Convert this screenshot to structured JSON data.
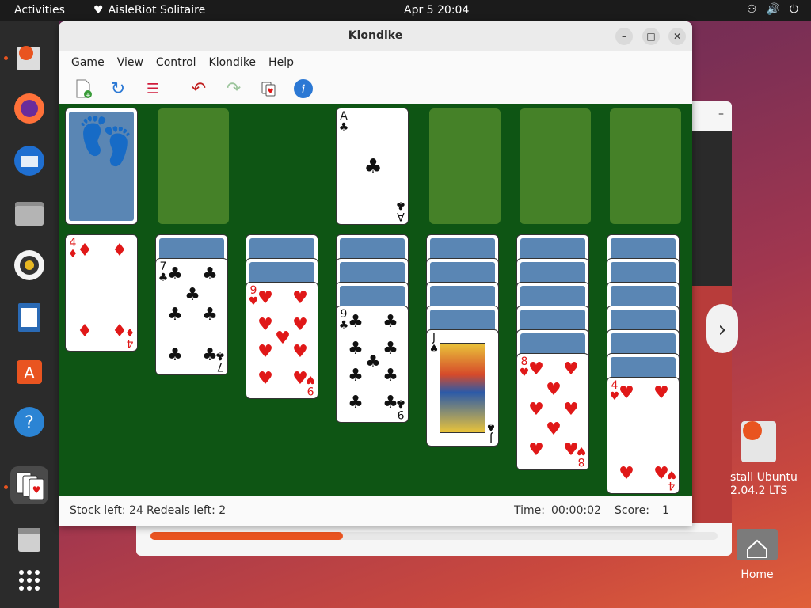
{
  "topbar": {
    "activities": "Activities",
    "app_name": "AisleRiot Solitaire",
    "clock": "Apr 5  20:04"
  },
  "window": {
    "title": "Klondike"
  },
  "menu": [
    "Game",
    "View",
    "Control",
    "Klondike",
    "Help"
  ],
  "status": {
    "stock": "Stock left: 24",
    "redeals": "Redeals left: 2",
    "time_label": "Time:",
    "time_value": "00:00:02",
    "score_label": "Score:",
    "score_value": "1"
  },
  "desktop": {
    "installer_label_1": "stall Ubuntu",
    "installer_label_2": "2.04.2 LTS",
    "home_label": "Home"
  },
  "installer": {
    "progress_percent": 34
  },
  "colors": {
    "felt": "#0e5514",
    "slot": "#4f8a2c",
    "card_back": "#5a86b4",
    "accent": "#e95420"
  },
  "cards": {
    "foundation": {
      "rank": "A",
      "suit": "♣"
    },
    "tableau": [
      {
        "rank": "4",
        "suit": "♦"
      },
      {
        "rank": "7",
        "suit": "♣"
      },
      {
        "rank": "9",
        "suit": "♥"
      },
      {
        "rank": "9",
        "suit": "♣"
      },
      {
        "rank": "J",
        "suit": "♠"
      },
      {
        "rank": "8",
        "suit": "♥"
      },
      {
        "rank": "4",
        "suit": "♥"
      }
    ]
  }
}
